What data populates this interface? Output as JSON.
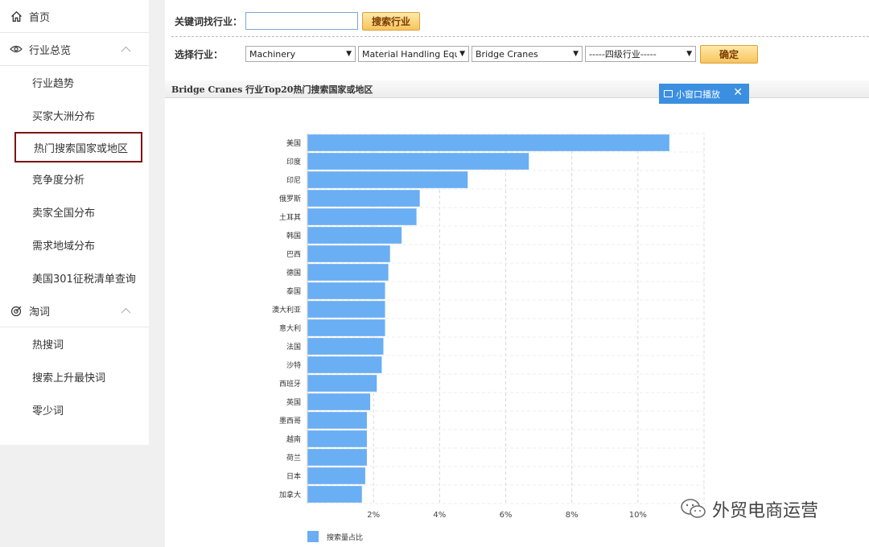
{
  "sidebar": {
    "home": "首页",
    "industry_overview": {
      "label": "行业总览",
      "items": [
        "行业趋势",
        "买家大洲分布",
        "热门搜索国家或地区",
        "竞争度分析",
        "卖家全国分布",
        "需求地域分布",
        "美国301征税清单查询"
      ]
    },
    "keywords": {
      "label": "淘词",
      "items": [
        "热搜词",
        "搜索上升最快词",
        "零少词"
      ]
    }
  },
  "search": {
    "label": "关键词找行业：",
    "value": "",
    "button": "搜索行业"
  },
  "select": {
    "label": "选择行业：",
    "level1": "Machinery",
    "level2": "Material Handling Equi",
    "level3": "Bridge Cranes",
    "level4": "-----四级行业-----",
    "confirm": "确定"
  },
  "chart_panel": {
    "title": "Bridge Cranes  行业Top20热门搜索国家或地区",
    "mini_window": "小窗口播放"
  },
  "chart_data": {
    "type": "bar",
    "orientation": "horizontal",
    "categories": [
      "美国",
      "印度",
      "印尼",
      "俄罗斯",
      "土耳其",
      "韩国",
      "巴西",
      "德国",
      "泰国",
      "澳大利亚",
      "意大利",
      "法国",
      "沙特",
      "西班牙",
      "英国",
      "墨西哥",
      "越南",
      "荷兰",
      "日本",
      "加拿大"
    ],
    "series": [
      {
        "name": "搜索量占比",
        "values": [
          10.95,
          6.7,
          4.85,
          3.4,
          3.3,
          2.85,
          2.5,
          2.45,
          2.35,
          2.35,
          2.35,
          2.3,
          2.25,
          2.1,
          1.9,
          1.8,
          1.8,
          1.8,
          1.75,
          1.65
        ],
        "color": "#6aaef4"
      }
    ],
    "xticks": [
      "2%",
      "4%",
      "6%",
      "8%",
      "10%"
    ],
    "xlim": [
      0,
      12
    ],
    "grid": true,
    "legend": "bottom-left"
  },
  "watermark": "外贸电商运营"
}
